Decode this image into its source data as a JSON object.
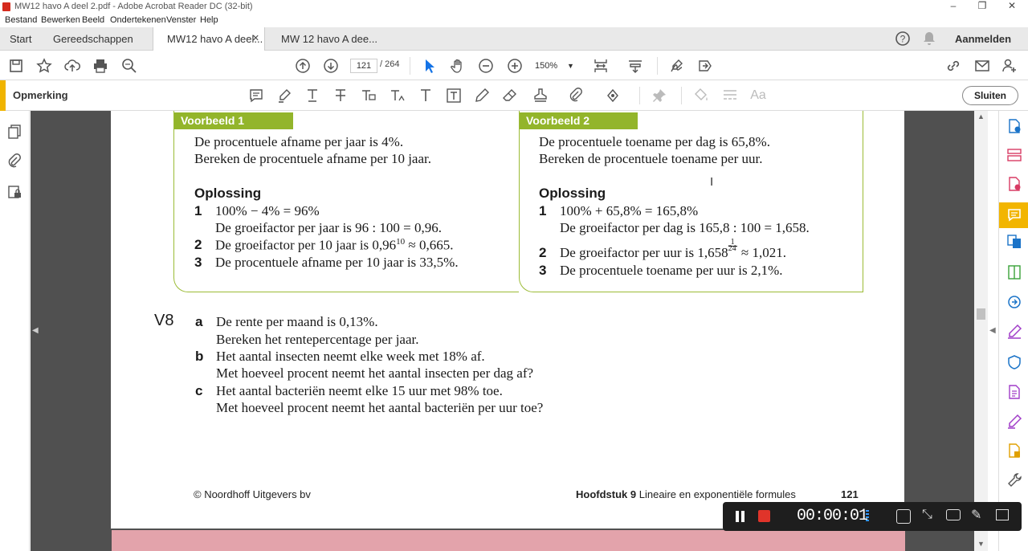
{
  "window": {
    "title": "MW12 havo A deel 2.pdf - Adobe Acrobat Reader DC (32-bit)"
  },
  "menu": [
    "Bestand",
    "Bewerken",
    "Beeld",
    "Ondertekenen",
    "Venster",
    "Help"
  ],
  "tabs": {
    "start": "Start",
    "tools": "Gereedschappen",
    "doc1": "MW12 havo A deel...",
    "doc2": "MW 12 havo A dee...",
    "signin": "Aanmelden"
  },
  "toolbar": {
    "page_current": "121",
    "page_total": "/  264",
    "zoom": "150%"
  },
  "commentbar": {
    "label": "Opmerking",
    "close": "Sluiten"
  },
  "colors": {
    "accent": "#f0b400",
    "box_green": "#93b52b",
    "pink": "#e3a3ab"
  },
  "example1": {
    "header": "Voorbeeld 1",
    "line1": "De procentuele afname per jaar is 4%.",
    "line2": "Bereken de procentuele afname per 10 jaar.",
    "solution": "Oplossing",
    "s1n": "1",
    "s1": "100% − 4% = 96%",
    "s1b": "De groeifactor per jaar is 96 : 100 = 0,96.",
    "s2n": "2",
    "s2a": "De groeifactor per 10 jaar is 0,96",
    "s2sup": "10",
    "s2b": " ≈ 0,665.",
    "s3n": "3",
    "s3": "De procentuele afname per 10 jaar is 33,5%."
  },
  "example2": {
    "header": "Voorbeeld 2",
    "line1": "De procentuele toename per dag is 65,8%.",
    "line2": "Bereken de procentuele toename per uur.",
    "solution": "Oplossing",
    "s1n": "1",
    "s1": "100% + 65,8% = 165,8%",
    "s1b": "De groeifactor per dag is 165,8 : 100 = 1,658.",
    "s2n": "2",
    "s2a": "De groeifactor per uur is 1,658",
    "s2num": "1",
    "s2den": "24",
    "s2b": " ≈ 1,021.",
    "s3n": "3",
    "s3": "De procentuele toename per uur is 2,1%."
  },
  "exercise": {
    "id": "V8",
    "a": "a",
    "a1": "De rente per maand is 0,13%.",
    "a2": "Bereken het rentepercentage per jaar.",
    "b": "b",
    "b1": "Het aantal insecten neemt elke week met 18% af.",
    "b2": "Met hoeveel procent neemt het aantal insecten per dag af?",
    "c": "c",
    "c1": "Het aantal bacteriën neemt elke 15 uur met 98% toe.",
    "c2": "Met hoeveel procent neemt het aantal bacteriën per uur toe?"
  },
  "footer": {
    "publisher": "© Noordhoff Uitgevers bv",
    "chapter": "Hoofdstuk 9",
    "chapter_title": "Lineaire en exponentiële formules",
    "page": "121"
  },
  "recorder": {
    "time": "00:00:01"
  }
}
